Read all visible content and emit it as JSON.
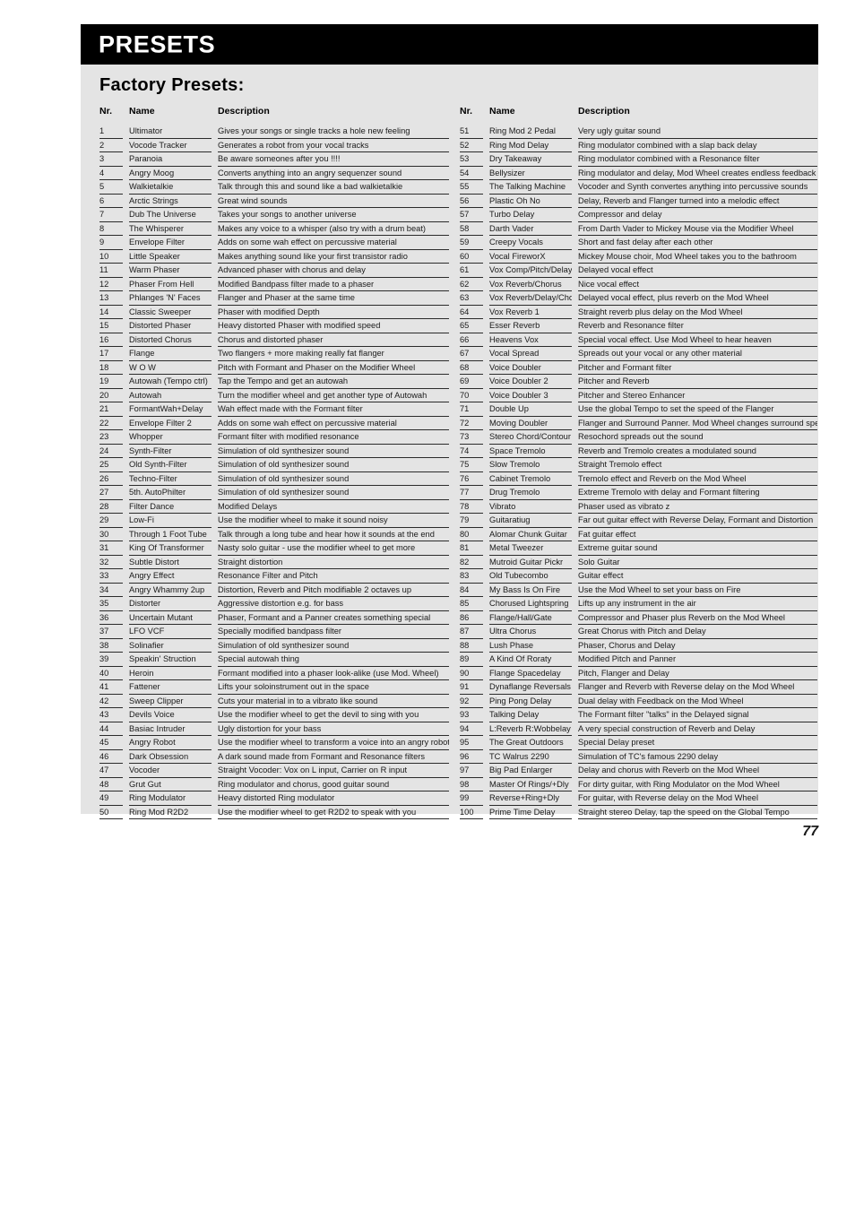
{
  "chapter": {
    "title": "PRESETS",
    "bar_color": "#000000",
    "text_color": "#ffffff"
  },
  "section": {
    "title": "Factory Presets:",
    "panel_color": "#e4e4e4"
  },
  "page_number": "77",
  "table": {
    "headers": {
      "nr": "Nr.",
      "name": "Name",
      "description": "Description"
    },
    "left_rows": [
      {
        "nr": "1",
        "name": "Ultimator",
        "description": "Gives your songs or single tracks a hole new feeling"
      },
      {
        "nr": "2",
        "name": "Vocode Tracker",
        "description": "Generates a robot from your vocal tracks"
      },
      {
        "nr": "3",
        "name": "Paranoia",
        "description": "Be aware someones after you !!!!"
      },
      {
        "nr": "4",
        "name": "Angry Moog",
        "description": "Converts anything into an angry sequenzer sound"
      },
      {
        "nr": "5",
        "name": "Walkietalkie",
        "description": "Talk through this and sound like a bad walkietalkie"
      },
      {
        "nr": "6",
        "name": "Arctic Strings",
        "description": "Great wind sounds"
      },
      {
        "nr": "7",
        "name": "Dub The Universe",
        "description": "Takes your songs to another universe"
      },
      {
        "nr": "8",
        "name": "The Whisperer",
        "description": "Makes any voice to a whisper (also try with a drum beat)"
      },
      {
        "nr": "9",
        "name": "Envelope Filter",
        "description": "Adds on some wah effect on percussive material"
      },
      {
        "nr": "10",
        "name": "Little Speaker",
        "description": "Makes anything sound like your first transistor radio"
      },
      {
        "nr": "11",
        "name": "Warm Phaser",
        "description": "Advanced phaser with chorus and delay"
      },
      {
        "nr": "12",
        "name": "Phaser From Hell",
        "description": "Modified Bandpass filter made to a phaser"
      },
      {
        "nr": "13",
        "name": "Phlanges 'N' Faces",
        "description": "Flanger and Phaser at the same time"
      },
      {
        "nr": "14",
        "name": "Classic Sweeper",
        "description": "Phaser with modified Depth"
      },
      {
        "nr": "15",
        "name": "Distorted Phaser",
        "description": "Heavy distorted Phaser with modified speed"
      },
      {
        "nr": "16",
        "name": "Distorted Chorus",
        "description": "Chorus and distorted phaser"
      },
      {
        "nr": "17",
        "name": "Flange",
        "description": "Two flangers + more making really fat flanger"
      },
      {
        "nr": "18",
        "name": "W O W",
        "description": "Pitch with Formant and Phaser on the Modifier Wheel"
      },
      {
        "nr": "19",
        "name": "Autowah (Tempo ctrl)",
        "description": "Tap the Tempo and get an autowah"
      },
      {
        "nr": "20",
        "name": "Autowah",
        "description": "Turn the modifier wheel and get another type of Autowah"
      },
      {
        "nr": "21",
        "name": "FormantWah+Delay",
        "description": "Wah effect made with the Formant filter"
      },
      {
        "nr": "22",
        "name": "Envelope Filter 2",
        "description": "Adds on some wah effect on percussive material"
      },
      {
        "nr": "23",
        "name": "Whopper",
        "description": "Formant filter with modified resonance"
      },
      {
        "nr": "24",
        "name": "Synth-Filter",
        "description": "Simulation of old synthesizer sound"
      },
      {
        "nr": "25",
        "name": "Old Synth-Filter",
        "description": "Simulation of old synthesizer sound"
      },
      {
        "nr": "26",
        "name": "Techno-Filter",
        "description": "Simulation of old synthesizer sound"
      },
      {
        "nr": "27",
        "name": "5th. AutoPhilter",
        "description": "Simulation of old synthesizer sound"
      },
      {
        "nr": "28",
        "name": "Filter Dance",
        "description": "Modified Delays"
      },
      {
        "nr": "29",
        "name": "Low-Fi",
        "description": "Use the modifier wheel to make it sound noisy"
      },
      {
        "nr": "30",
        "name": "Through 1 Foot Tube",
        "description": "Talk through a long tube and hear how it sounds at the end"
      },
      {
        "nr": "31",
        "name": "King Of Transformer",
        "description": "Nasty solo guitar - use the modifier wheel to get more"
      },
      {
        "nr": "32",
        "name": "Subtle Distort",
        "description": "Straight distortion"
      },
      {
        "nr": "33",
        "name": "Angry Effect",
        "description": "Resonance Filter and Pitch"
      },
      {
        "nr": "34",
        "name": "Angry Whammy 2up",
        "description": "Distortion, Reverb and Pitch modifiable 2 octaves up"
      },
      {
        "nr": "35",
        "name": "Distorter",
        "description": "Aggressive distortion e.g. for bass"
      },
      {
        "nr": "36",
        "name": "Uncertain Mutant",
        "description": "Phaser, Formant and a Panner creates something special"
      },
      {
        "nr": "37",
        "name": "LFO VCF",
        "description": "Specially modified bandpass filter"
      },
      {
        "nr": "38",
        "name": "Solinafier",
        "description": "Simulation of old synthesizer sound"
      },
      {
        "nr": "39",
        "name": "Speakin' Struction",
        "description": "Special autowah thing"
      },
      {
        "nr": "40",
        "name": "Heroin",
        "description": "Formant modified into a phaser look-alike (use Mod. Wheel)"
      },
      {
        "nr": "41",
        "name": "Fattener",
        "description": "Lifts your soloinstrument out in the space"
      },
      {
        "nr": "42",
        "name": "Sweep Clipper",
        "description": "Cuts your material in to a vibrato like sound"
      },
      {
        "nr": "43",
        "name": "Devils Voice",
        "description": "Use the modifier wheel to get the devil to sing with you"
      },
      {
        "nr": "44",
        "name": "Basiac Intruder",
        "description": "Ugly distortion for your bass"
      },
      {
        "nr": "45",
        "name": "Angry Robot",
        "description": "Use the modifier wheel to transform a voice into an angry robot"
      },
      {
        "nr": "46",
        "name": "Dark Obsession",
        "description": "A dark sound made from Formant and Resonance filters"
      },
      {
        "nr": "47",
        "name": "Vocoder",
        "description": "Straight Vocoder: Vox on L input, Carrier on R input"
      },
      {
        "nr": "48",
        "name": "Grut Gut",
        "description": "Ring modulator and chorus, good guitar sound"
      },
      {
        "nr": "49",
        "name": "Ring Modulator",
        "description": "Heavy distorted Ring modulator"
      },
      {
        "nr": "50",
        "name": "Ring Mod R2D2",
        "description": "Use the modifier wheel to get R2D2 to speak with you"
      }
    ],
    "right_rows": [
      {
        "nr": "51",
        "name": "Ring Mod 2 Pedal",
        "description": "Very ugly guitar sound"
      },
      {
        "nr": "52",
        "name": "Ring Mod Delay",
        "description": "Ring modulator combined with a slap back delay"
      },
      {
        "nr": "53",
        "name": "Dry Takeaway",
        "description": "Ring modulator combined with a Resonance filter"
      },
      {
        "nr": "54",
        "name": "Bellysizer",
        "description": "Ring modulator and delay, Mod Wheel creates endless feedback"
      },
      {
        "nr": "55",
        "name": "The Talking Machine",
        "description": "Vocoder and Synth convertes anything into percussive sounds"
      },
      {
        "nr": "56",
        "name": "Plastic Oh No",
        "description": "Delay, Reverb and Flanger turned into a melodic effect"
      },
      {
        "nr": "57",
        "name": "Turbo Delay",
        "description": "Compressor and delay"
      },
      {
        "nr": "58",
        "name": "Darth Vader",
        "description": "From Darth Vader to Mickey Mouse via the Modifier Wheel"
      },
      {
        "nr": "59",
        "name": "Creepy Vocals",
        "description": "Short and fast delay after each other"
      },
      {
        "nr": "60",
        "name": "Vocal FireworX",
        "description": "Mickey Mouse choir, Mod Wheel takes you to the bathroom"
      },
      {
        "nr": "61",
        "name": "Vox Comp/Pitch/Delay",
        "description": "Delayed vocal effect"
      },
      {
        "nr": "62",
        "name": "Vox Reverb/Chorus",
        "description": "Nice vocal effect"
      },
      {
        "nr": "63",
        "name": "Vox Reverb/Delay/Cho",
        "description": "Delayed vocal effect, plus reverb on the Mod Wheel"
      },
      {
        "nr": "64",
        "name": "Vox Reverb 1",
        "description": "Straight reverb plus delay on the Mod Wheel"
      },
      {
        "nr": "65",
        "name": "Esser Reverb",
        "description": "Reverb and Resonance filter"
      },
      {
        "nr": "66",
        "name": "Heavens Vox",
        "description": "Special vocal effect. Use Mod Wheel to hear heaven"
      },
      {
        "nr": "67",
        "name": "Vocal Spread",
        "description": "Spreads out your vocal or any other material"
      },
      {
        "nr": "68",
        "name": "Voice Doubler",
        "description": "Pitcher and Formant filter"
      },
      {
        "nr": "69",
        "name": "Voice Doubler 2",
        "description": "Pitcher and Reverb"
      },
      {
        "nr": "70",
        "name": "Voice Doubler 3",
        "description": "Pitcher and Stereo Enhancer"
      },
      {
        "nr": "71",
        "name": "Double Up",
        "description": "Use the global Tempo to set the speed of the Flanger"
      },
      {
        "nr": "72",
        "name": "Moving Doubler",
        "description": "Flanger and Surround Panner. Mod Wheel changes surround speed"
      },
      {
        "nr": "73",
        "name": "Stereo Chord/Contour",
        "description": "Resochord spreads out the sound"
      },
      {
        "nr": "74",
        "name": "Space Tremolo",
        "description": "Reverb and Tremolo creates a modulated sound"
      },
      {
        "nr": "75",
        "name": "Slow Tremolo",
        "description": "Straight Tremolo effect"
      },
      {
        "nr": "76",
        "name": "Cabinet Tremolo",
        "description": "Tremolo effect and Reverb on the Mod Wheel"
      },
      {
        "nr": "77",
        "name": "Drug Tremolo",
        "description": "Extreme Tremolo with delay and Formant filtering"
      },
      {
        "nr": "78",
        "name": "Vibrato",
        "description": "Phaser used as vibrato z"
      },
      {
        "nr": "79",
        "name": "Guitaratiug",
        "description": "Far out guitar effect with Reverse Delay, Formant and Distortion"
      },
      {
        "nr": "80",
        "name": "Alomar Chunk Guitar",
        "description": "Fat guitar effect"
      },
      {
        "nr": "81",
        "name": "Metal Tweezer",
        "description": "Extreme guitar sound"
      },
      {
        "nr": "82",
        "name": "Mutroid Guitar Pickr",
        "description": "Solo Guitar"
      },
      {
        "nr": "83",
        "name": "Old Tubecombo",
        "description": "Guitar effect"
      },
      {
        "nr": "84",
        "name": "My Bass Is On Fire",
        "description": "Use the Mod Wheel to set your bass on Fire"
      },
      {
        "nr": "85",
        "name": "Chorused Lightspring",
        "description": "Lifts up any instrument in the air"
      },
      {
        "nr": "86",
        "name": "Flange/Hall/Gate",
        "description": "Compressor and Phaser plus Reverb on the Mod Wheel"
      },
      {
        "nr": "87",
        "name": "Ultra Chorus",
        "description": "Great Chorus with Pitch and Delay"
      },
      {
        "nr": "88",
        "name": "Lush Phase",
        "description": "Phaser, Chorus and Delay"
      },
      {
        "nr": "89",
        "name": "A Kind Of Roraty",
        "description": "Modified Pitch and Panner"
      },
      {
        "nr": "90",
        "name": "Flange Spacedelay",
        "description": "Pitch, Flanger and Delay"
      },
      {
        "nr": "91",
        "name": "Dynaflange Reversals",
        "description": "Flanger and Reverb with Reverse delay on the Mod Wheel"
      },
      {
        "nr": "92",
        "name": "Ping Pong Delay",
        "description": "Dual delay with Feedback on the Mod Wheel"
      },
      {
        "nr": "93",
        "name": "Talking Delay",
        "description": "The Formant filter \"talks\" in the Delayed signal"
      },
      {
        "nr": "94",
        "name": "L:Reverb R:Wobbelay",
        "description": "A very special construction of Reverb and Delay"
      },
      {
        "nr": "95",
        "name": "The Great Outdoors",
        "description": "Special Delay preset"
      },
      {
        "nr": "96",
        "name": "TC Walrus 2290",
        "description": "Simulation of TC's famous 2290 delay"
      },
      {
        "nr": "97",
        "name": "Big Pad Enlarger",
        "description": "Delay and chorus with Reverb on the Mod Wheel"
      },
      {
        "nr": "98",
        "name": "Master Of Rings/+Dly",
        "description": "For dirty guitar, with Ring Modulator on the Mod Wheel"
      },
      {
        "nr": "99",
        "name": "Reverse+Ring+Dly",
        "description": "For guitar, with Reverse delay on the Mod Wheel"
      },
      {
        "nr": "100",
        "name": "Prime Time Delay",
        "description": "Straight stereo Delay, tap the speed on the Global Tempo"
      }
    ]
  }
}
